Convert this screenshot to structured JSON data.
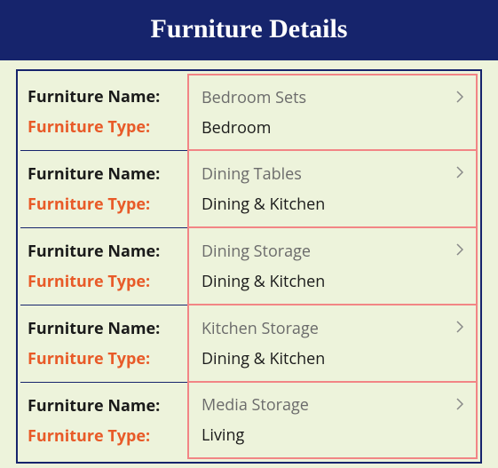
{
  "header": {
    "title": "Furniture Details"
  },
  "labels": {
    "name": "Furniture Name:",
    "type": "Furniture Type:"
  },
  "rows": [
    {
      "name": "Bedroom Sets",
      "type": "Bedroom"
    },
    {
      "name": "Dining Tables",
      "type": "Dining & Kitchen"
    },
    {
      "name": "Dining Storage",
      "type": "Dining & Kitchen"
    },
    {
      "name": "Kitchen Storage",
      "type": "Dining & Kitchen"
    },
    {
      "name": "Media Storage",
      "type": "Living"
    }
  ]
}
